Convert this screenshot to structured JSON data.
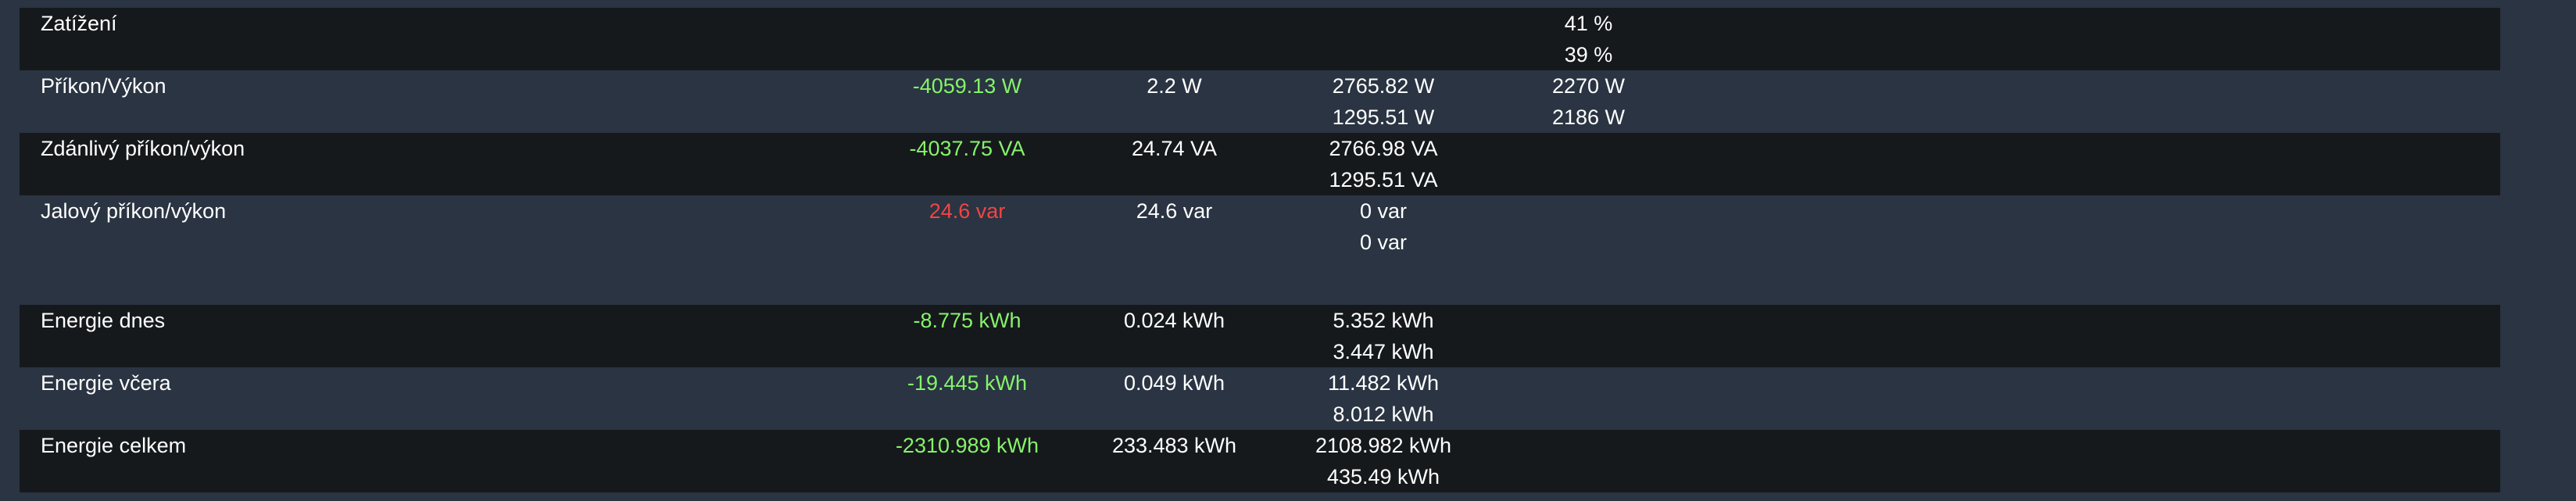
{
  "rows": {
    "zatizeni": {
      "label": "Zatížení",
      "col4_a": "41 %",
      "col4_b": "39 %"
    },
    "prikon": {
      "label": "Příkon/Výkon",
      "col1": "-4059.13 W",
      "col2": "2.2 W",
      "col3_a": "2765.82 W",
      "col3_b": "1295.51 W",
      "col4_a": "2270 W",
      "col4_b": "2186 W"
    },
    "zdanlivy": {
      "label": "Zdánlivý příkon/výkon",
      "col1": "-4037.75 VA",
      "col2": "24.74 VA",
      "col3_a": "2766.98 VA",
      "col3_b": "1295.51 VA"
    },
    "jalovy": {
      "label": "Jalový příkon/výkon",
      "col1": "24.6 var",
      "col2": "24.6 var",
      "col3_a": "0 var",
      "col3_b": "0 var"
    },
    "energie_dnes": {
      "label": "Energie dnes",
      "col1": "-8.775 kWh",
      "col2": "0.024 kWh",
      "col3_a": "5.352 kWh",
      "col3_b": "3.447 kWh"
    },
    "energie_vcera": {
      "label": "Energie včera",
      "col1": "-19.445 kWh",
      "col2": "0.049 kWh",
      "col3_a": "11.482 kWh",
      "col3_b": "8.012 kWh"
    },
    "energie_celkem": {
      "label": "Energie celkem",
      "col1": "-2310.989 kWh",
      "col2": "233.483 kWh",
      "col3_a": "2108.982 kWh",
      "col3_b": "435.49 kWh"
    }
  },
  "colors": {
    "background": "#2a3442",
    "row_dark": "#16191c",
    "positive_value": "#86f36a",
    "negative_value": "#f34444",
    "text": "#ffffff"
  }
}
